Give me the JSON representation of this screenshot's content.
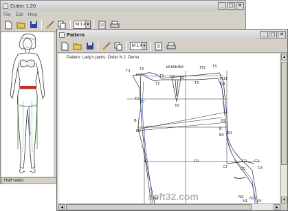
{
  "main_window": {
    "title": "Cutter 1.20",
    "menu": [
      "File",
      "Edit",
      "Help"
    ],
    "scale": "M 1:4",
    "status": "Half waist"
  },
  "pattern_window": {
    "title": "Pattern",
    "scale": "M 1:4",
    "pattern_label": "Pattern:  Lady's pants. Order N 2. Demo"
  },
  "points": [
    "T3",
    "T6",
    "b5",
    "b6",
    "b4",
    "b6",
    "T51",
    "T5",
    "T4",
    "T2",
    "T1",
    "b4",
    "b2",
    "T0",
    "T111",
    "T11",
    "T1",
    "T7",
    "T",
    "B",
    "b0",
    "B2",
    "B3",
    "B",
    "B4",
    "B1",
    "C",
    "C0",
    "C1",
    "C2",
    "C5",
    "C3",
    "C4",
    "N4",
    "N3",
    "N2",
    "N1",
    "N"
  ],
  "watermark": "soft32.com"
}
